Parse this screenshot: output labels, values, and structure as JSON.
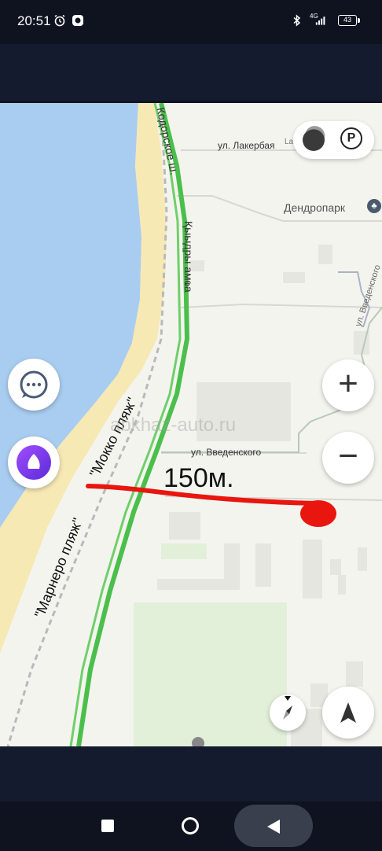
{
  "status_bar": {
    "time": "20:51",
    "network": "4G",
    "battery": "43",
    "icons": [
      "alarm-icon",
      "app-notification-icon",
      "bluetooth-icon",
      "signal-icon",
      "battery-icon"
    ]
  },
  "map": {
    "labels": {
      "street_lakerbaya": "ул. Лакербая",
      "street_lakerbaya_cut": "La",
      "park": "Дендропарк",
      "road_kodorskoe": "Кодорское ш.",
      "road_kyydrya": "Қыыдры амҩа",
      "street_vvedenskogo_side": "ул. Введенского",
      "street_vvedenskogo": "ул. Введенского",
      "beach_mokko": "\"Мокко пляж\"",
      "beach_marnero": "\"Марнеро пляж\"",
      "distance_note": "150м.",
      "watermark": "abkhaz-auto.ru"
    },
    "colors": {
      "water": "#a9cdf0",
      "sand": "#f7e9b4",
      "land": "#f4f4ef",
      "green_road": "#4bbf4b",
      "park_green": "#e2efd9",
      "annotation_red": "#e8160f"
    }
  },
  "controls": {
    "chat_button": "chat-icon",
    "alice_button": "alice-icon",
    "zoom_in": "+",
    "zoom_out": "−",
    "layers_button": "layers-icon",
    "parking_button": "P",
    "compass_button": "compass-icon",
    "navigate_button": "navigation-arrow-icon"
  },
  "nav_bar": {
    "buttons": [
      "square-button",
      "home-button",
      "back-button"
    ]
  }
}
